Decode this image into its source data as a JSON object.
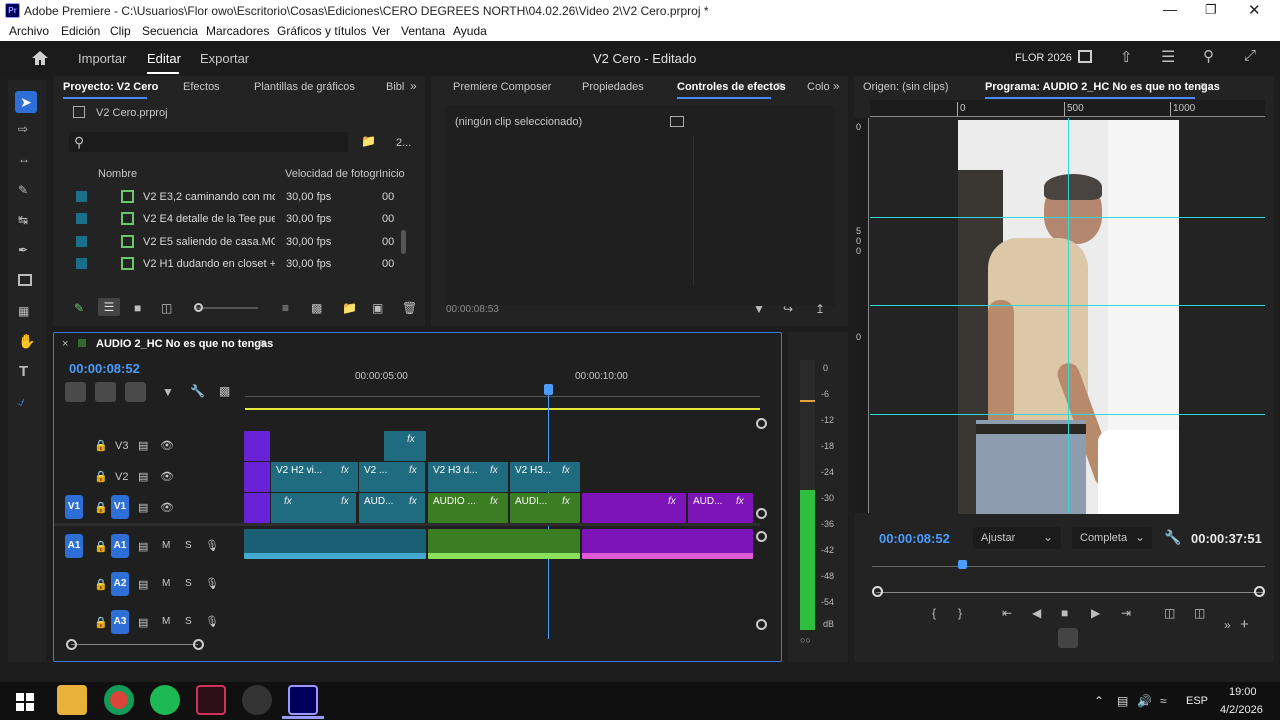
{
  "window": {
    "title": "Adobe Premiere - C:\\Usuarios\\Flor owo\\Escritorio\\Cosas\\Ediciones\\CERO DEGREES NORTH\\04.02.26\\Video 2\\V2 Cero.prproj *",
    "app_icon": "Pr"
  },
  "menu": [
    "Archivo",
    "Edición",
    "Clip",
    "Secuencia",
    "Marcadores",
    "Gráficos y títulos",
    "Ver",
    "Ventana",
    "Ayuda"
  ],
  "header": {
    "tabs": [
      "Importar",
      "Editar",
      "Exportar"
    ],
    "active_tab": "Editar",
    "doc_title": "V2 Cero - Editado",
    "user": "FLOR 2026"
  },
  "project": {
    "tabs": [
      "Proyecto: V2 Cero",
      "Efectos",
      "Plantillas de gráficos",
      "Bibl"
    ],
    "file": "V2 Cero.prproj",
    "count": "2...",
    "col_name": "Nombre",
    "col_fps": "Velocidad de fotogr",
    "col_start": "Inicio",
    "rows": [
      {
        "name": "V2 E3,2 caminando con moc",
        "fps": "30,00 fps",
        "start": "00"
      },
      {
        "name": "V2 E4 detalle de la Tee puest",
        "fps": "30,00 fps",
        "start": "00"
      },
      {
        "name": "V2 E5 saliendo de casa.MOV",
        "fps": "30,00 fps",
        "start": "00"
      },
      {
        "name": "V2 H1 dudando en closet + s",
        "fps": "30,00 fps",
        "start": "00"
      }
    ]
  },
  "effects": {
    "tabs": [
      "Premiere Composer",
      "Propiedades",
      "Controles de efectos",
      "Colo"
    ],
    "no_clip": "(ningún clip seleccionado)",
    "time": "00:00:08:53"
  },
  "monitor": {
    "tabs": [
      "Origen: (sin clips)",
      "Programa: AUDIO 2_HC No es que no tengas"
    ],
    "ruler": [
      "0",
      "500",
      "1000"
    ],
    "vruler": [
      "0",
      "500",
      "0"
    ],
    "timecode": "00:00:08:52",
    "fit": "Ajustar",
    "quality": "Completa",
    "duration": "00:00:37:51"
  },
  "timeline": {
    "seq_name": "AUDIO 2_HC No es que no tengas",
    "timecode": "00:00:08:52",
    "ticks": [
      "00:00:05:00",
      "00:00:10:00"
    ],
    "tracks_video": [
      "V3",
      "V2",
      "V1"
    ],
    "tracks_audio": [
      "A1",
      "A2",
      "A3"
    ],
    "src_v": "V1",
    "src_a": "A1",
    "m": "M",
    "s": "S",
    "clip_labels": {
      "v2a": "V2 H2 vi...",
      "v2b": "V2 ...",
      "v2c": "V2 H3 d...",
      "v2d": "V2 H3...",
      "v1a": "AUD...",
      "v1b": "AUDIO ...",
      "v1c": "AUDI...",
      "v1d": "AUD..."
    },
    "fx": "fx"
  },
  "meter": {
    "labels": [
      "0",
      "-6",
      "-12",
      "-18",
      "-24",
      "-30",
      "-36",
      "-42",
      "-48",
      "-54",
      "dB"
    ],
    "level": 0.52
  },
  "taskbar": {
    "lang": "ESP",
    "time": "19:00",
    "date": "4/2/2026"
  }
}
